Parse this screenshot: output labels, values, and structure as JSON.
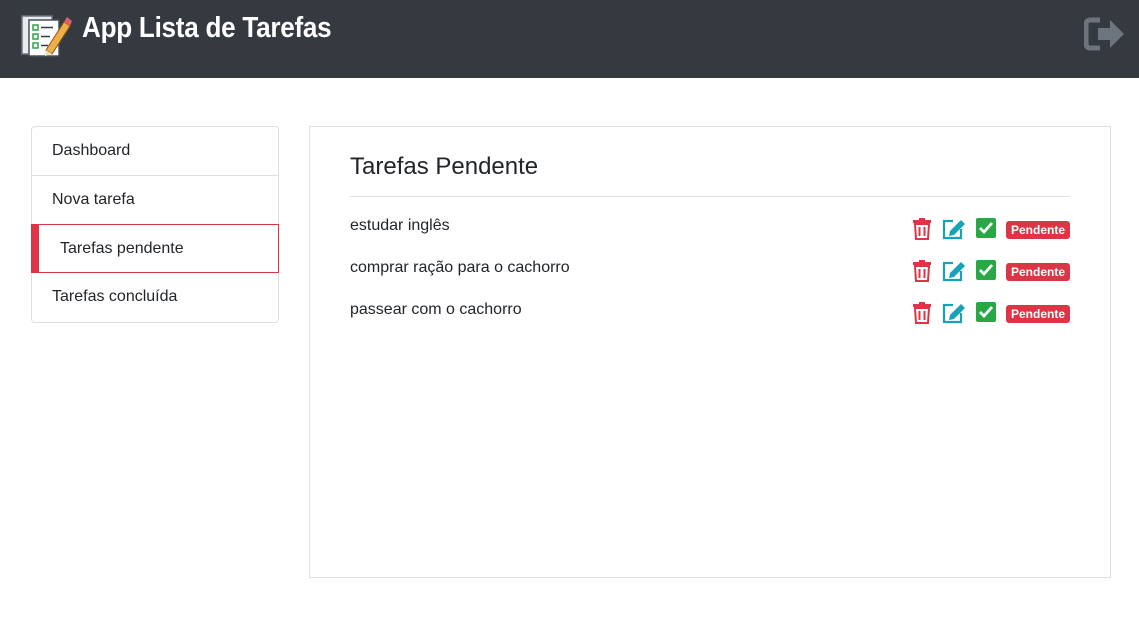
{
  "header": {
    "title": "App Lista de Tarefas",
    "logo_icon": "checklist-pencil-icon",
    "logout_icon": "sign-out-icon",
    "background_color": "#343a40"
  },
  "sidebar": {
    "items": [
      {
        "label": "Dashboard",
        "active": false
      },
      {
        "label": "Nova tarefa",
        "active": false
      },
      {
        "label": "Tarefas pendente",
        "active": true
      },
      {
        "label": "Tarefas concluída",
        "active": false
      }
    ],
    "active_color": "#dc3545"
  },
  "main": {
    "title": "Tarefas Pendente",
    "tasks": [
      {
        "text": "estudar inglês",
        "status": "Pendente"
      },
      {
        "text": "comprar ração para o cachorro",
        "status": "Pendente"
      },
      {
        "text": "passear com o cachorro",
        "status": "Pendente"
      }
    ],
    "action_icons": [
      "trash-icon",
      "edit-icon",
      "check-square-icon"
    ],
    "colors": {
      "delete": "#dc3545",
      "edit": "#17a2b8",
      "complete": "#28a745",
      "badge": "#dc3545"
    }
  }
}
